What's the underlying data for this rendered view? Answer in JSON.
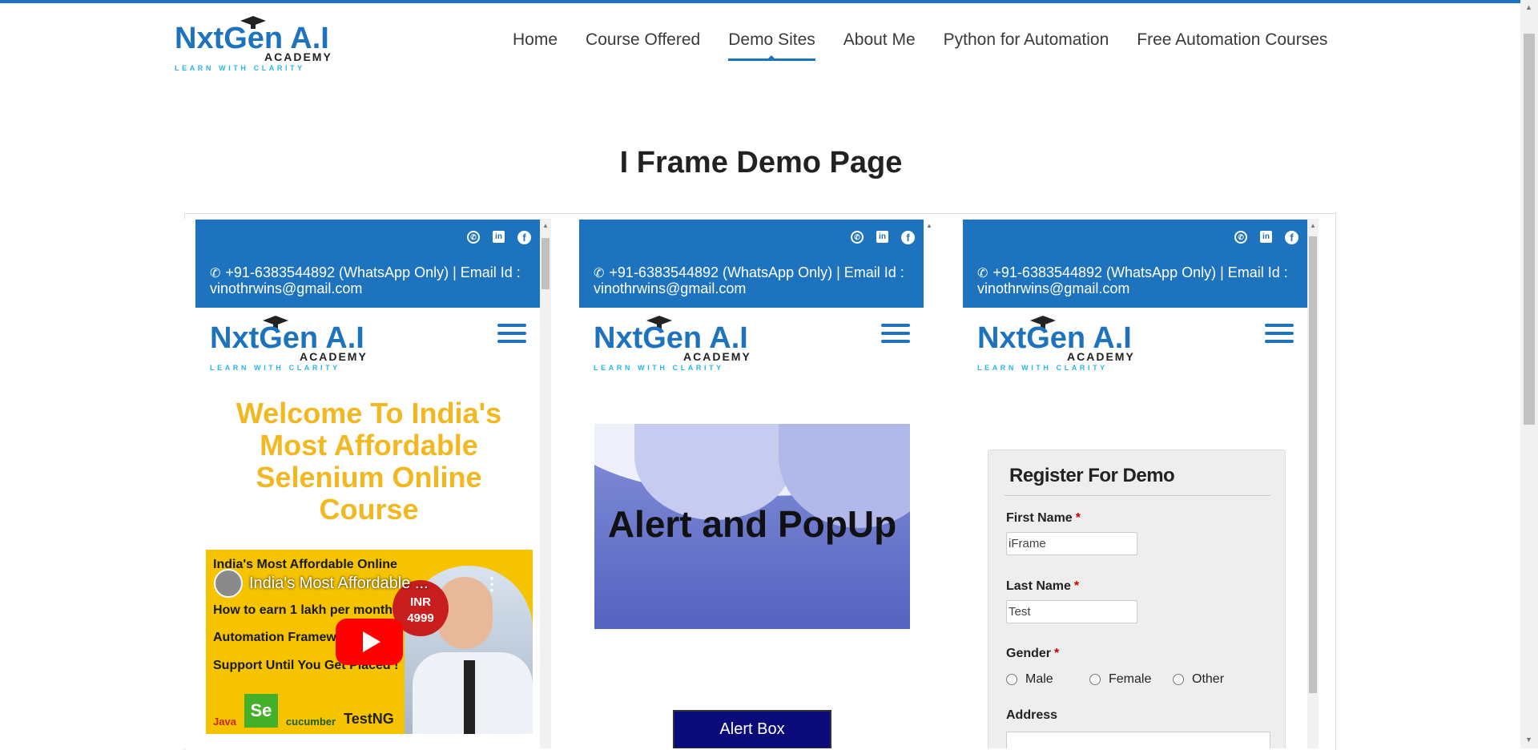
{
  "header": {
    "logo_main": "NxtGen A.I",
    "logo_sub": "ACADEMY",
    "logo_tag": "LEARN WITH CLARITY",
    "nav": [
      {
        "label": "Home"
      },
      {
        "label": "Course Offered"
      },
      {
        "label": "Demo Sites",
        "active": true
      },
      {
        "label": "About Me"
      },
      {
        "label": "Python for Automation"
      },
      {
        "label": "Free Automation Courses"
      }
    ]
  },
  "page": {
    "title": "I Frame Demo Page"
  },
  "iframes": {
    "contact": "+91-6383544892 (WhatsApp Only) | Email Id : vinothrwins@gmail.com",
    "social_icons": [
      "whatsapp-icon",
      "linkedin-icon",
      "facebook-icon"
    ],
    "logo_main": "NxtGen A.I",
    "logo_sub": "ACADEMY",
    "logo_tag": "LEARN WITH CLARITY",
    "first": {
      "welcome": "Welcome To India's Most Affordable Selenium Online Course",
      "video": {
        "title": "India's Most Affordable ...",
        "line1": "India's Most Affordable Online",
        "line2": "How to earn 1 lakh per month?",
        "line3": "Automation Framework",
        "line4": "Support Until You Get Placed !",
        "price_label": "INR",
        "price": "4999",
        "logos": [
          "Java",
          "Se",
          "cucumber",
          "TestNG"
        ]
      }
    },
    "second": {
      "banner_title": "Alert and PopUp",
      "button": "Alert Box"
    },
    "third": {
      "form_title": "Register For Demo",
      "first_name_label": "First Name",
      "first_name_value": "iFrame",
      "last_name_label": "Last Name",
      "last_name_value": "Test",
      "gender_label": "Gender",
      "gender_options": [
        "Male",
        "Female",
        "Other"
      ],
      "address_label": "Address",
      "required_mark": "*"
    }
  },
  "colors": {
    "accent": "#1e73be",
    "welcome": "#f3b81f",
    "alert_button": "#0a0a7a"
  }
}
